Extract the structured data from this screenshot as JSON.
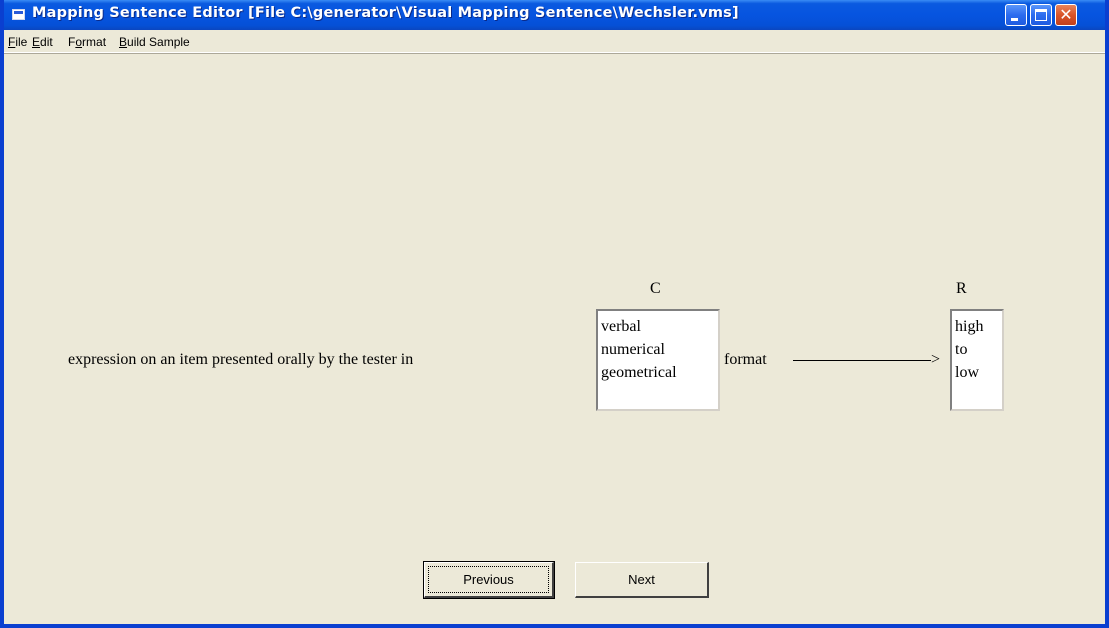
{
  "window": {
    "title": "Mapping Sentence Editor [File C:\\generator\\Visual Mapping Sentence\\Wechsler.vms]"
  },
  "menu": {
    "items": [
      {
        "mnemonic": "F",
        "rest": "ile"
      },
      {
        "mnemonic": "E",
        "rest": "dit"
      },
      {
        "pre": "F",
        "mnemonic": "o",
        "rest": "rmat"
      },
      {
        "mnemonic": "B",
        "rest": "uild Sample"
      }
    ]
  },
  "content": {
    "sentence": "expression on an item presented orally by the tester in",
    "facet_c": {
      "label": "C",
      "elements": [
        "verbal",
        "numerical",
        "geometrical"
      ]
    },
    "connector": "format",
    "arrow_head": ">",
    "facet_r": {
      "label": "R",
      "elements": [
        "high",
        "to",
        "low"
      ]
    }
  },
  "buttons": {
    "previous": "Previous",
    "next": "Next"
  },
  "colors": {
    "title_bar": "#0654e0",
    "window_bg": "#ece9d8",
    "close_button": "#d9542a"
  }
}
